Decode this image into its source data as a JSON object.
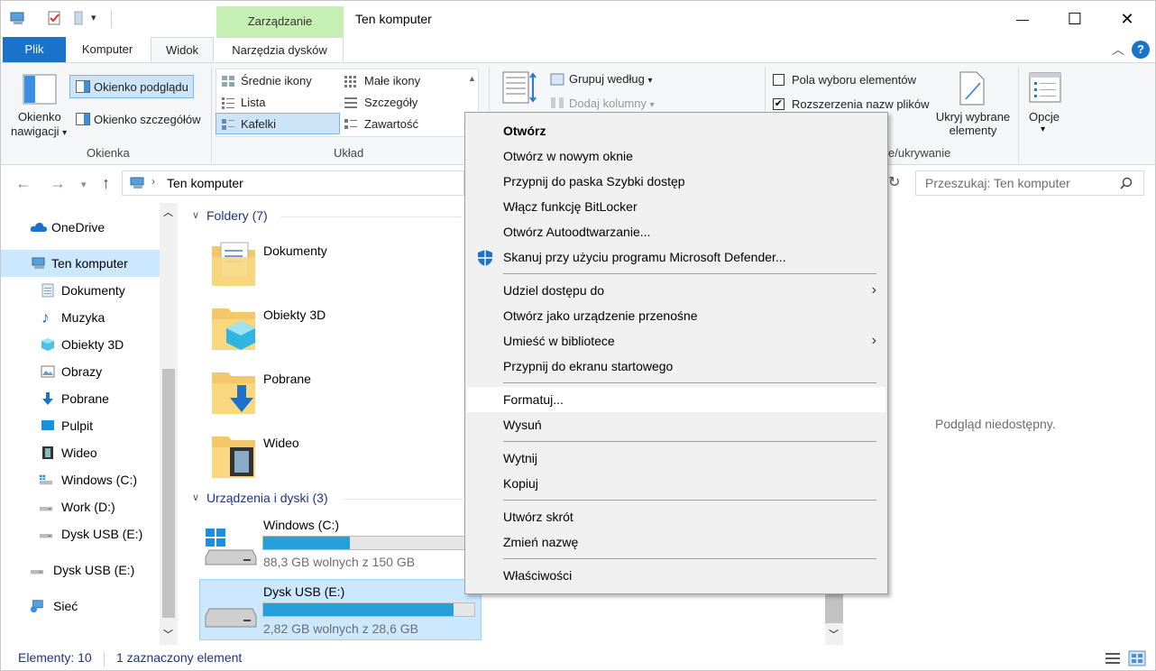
{
  "window": {
    "title": "Ten komputer",
    "manage_context_tab": "Zarządzanie",
    "minimize": "—",
    "maximize": "☐",
    "close": "✕"
  },
  "ribbon_tabs": {
    "plik": "Plik",
    "komputer": "Komputer",
    "widok": "Widok",
    "narzedzia": "Narzędzia dysków",
    "help": "?"
  },
  "ribbon": {
    "panes_group": {
      "name": "Okienka",
      "nav_pane": "Okienko\nnawigacji",
      "nav_pane_line1": "Okienko",
      "nav_pane_line2": "nawigacji",
      "preview_pane": "Okienko podglądu",
      "details_pane": "Okienko szczegółów"
    },
    "layout_group": {
      "name": "Układ",
      "items": [
        "Średnie ikony",
        "Małe ikony",
        "Lista",
        "Szczegóły",
        "Kafelki",
        "Zawartość"
      ],
      "selected": "Kafelki"
    },
    "current_view_group": {
      "group_by": "Grupuj według",
      "add_columns": "Dodaj kolumny"
    },
    "show_hide_group": {
      "name": "Pokaż/ukrywanie",
      "name_visible": "e/ukrywanie",
      "item_checkboxes": "Pola wyboru elementów",
      "item_checkboxes_checked": false,
      "file_extensions": "Rozszerzenia nazw plików",
      "file_extensions_checked": true,
      "hide_selected_line1": "Ukryj wybrane",
      "hide_selected_line2": "elementy"
    },
    "options": "Opcje"
  },
  "address": {
    "path": "Ten komputer",
    "search_placeholder": "Przeszukaj: Ten komputer"
  },
  "nav_pane": {
    "items": [
      {
        "label": "OneDrive",
        "icon": "cloud-icon"
      },
      {
        "label": "Ten komputer",
        "icon": "computer-icon",
        "selected": true
      },
      {
        "label": "Dokumenty",
        "icon": "documents-icon"
      },
      {
        "label": "Muzyka",
        "icon": "music-icon"
      },
      {
        "label": "Obiekty 3D",
        "icon": "cube-icon"
      },
      {
        "label": "Obrazy",
        "icon": "pictures-icon"
      },
      {
        "label": "Pobrane",
        "icon": "download-icon"
      },
      {
        "label": "Pulpit",
        "icon": "desktop-icon"
      },
      {
        "label": "Wideo",
        "icon": "video-icon"
      },
      {
        "label": "Windows (C:)",
        "icon": "drive-icon"
      },
      {
        "label": "Work (D:)",
        "icon": "drive-icon"
      },
      {
        "label": "Dysk USB (E:)",
        "icon": "usb-drive-icon"
      },
      {
        "label": "Dysk USB (E:)",
        "icon": "usb-drive-icon"
      },
      {
        "label": "Sieć",
        "icon": "network-icon"
      }
    ]
  },
  "content": {
    "folders_header": "Foldery (7)",
    "folders": [
      "Dokumenty",
      "Obiekty 3D",
      "Pobrane",
      "Wideo"
    ],
    "devices_header": "Urządzenia i dyski (3)",
    "drives": [
      {
        "name": "Windows (C:)",
        "free": "88,3 GB wolnych z 150 GB",
        "used_fraction": 0.41
      },
      {
        "name": "Dysk USB (E:)",
        "free": "2,82 GB wolnych z 28,6 GB",
        "used_fraction": 0.9,
        "selected": true
      }
    ]
  },
  "preview": {
    "text": "Podgląd niedostępny."
  },
  "status": {
    "count": "Elementy: 10",
    "selected": "1 zaznaczony element"
  },
  "context_menu": {
    "open": "Otwórz",
    "open_new_window": "Otwórz w nowym oknie",
    "pin_quick_access": "Przypnij do paska Szybki dostęp",
    "bitlocker": "Włącz funkcję BitLocker",
    "autoplay": "Otwórz Autoodtwarzanie...",
    "defender": "Skanuj przy użyciu programu Microsoft Defender...",
    "share": "Udziel dostępu do",
    "portable": "Otwórz jako urządzenie przenośne",
    "library": "Umieść w bibliotece",
    "pin_start": "Przypnij do ekranu startowego",
    "format": "Formatuj...",
    "eject": "Wysuń",
    "cut": "Wytnij",
    "copy": "Kopiuj",
    "shortcut": "Utwórz skrót",
    "rename": "Zmień nazwę",
    "properties": "Właściwości",
    "submenu_arrow": "›",
    "highlighted": "Formatuj..."
  }
}
